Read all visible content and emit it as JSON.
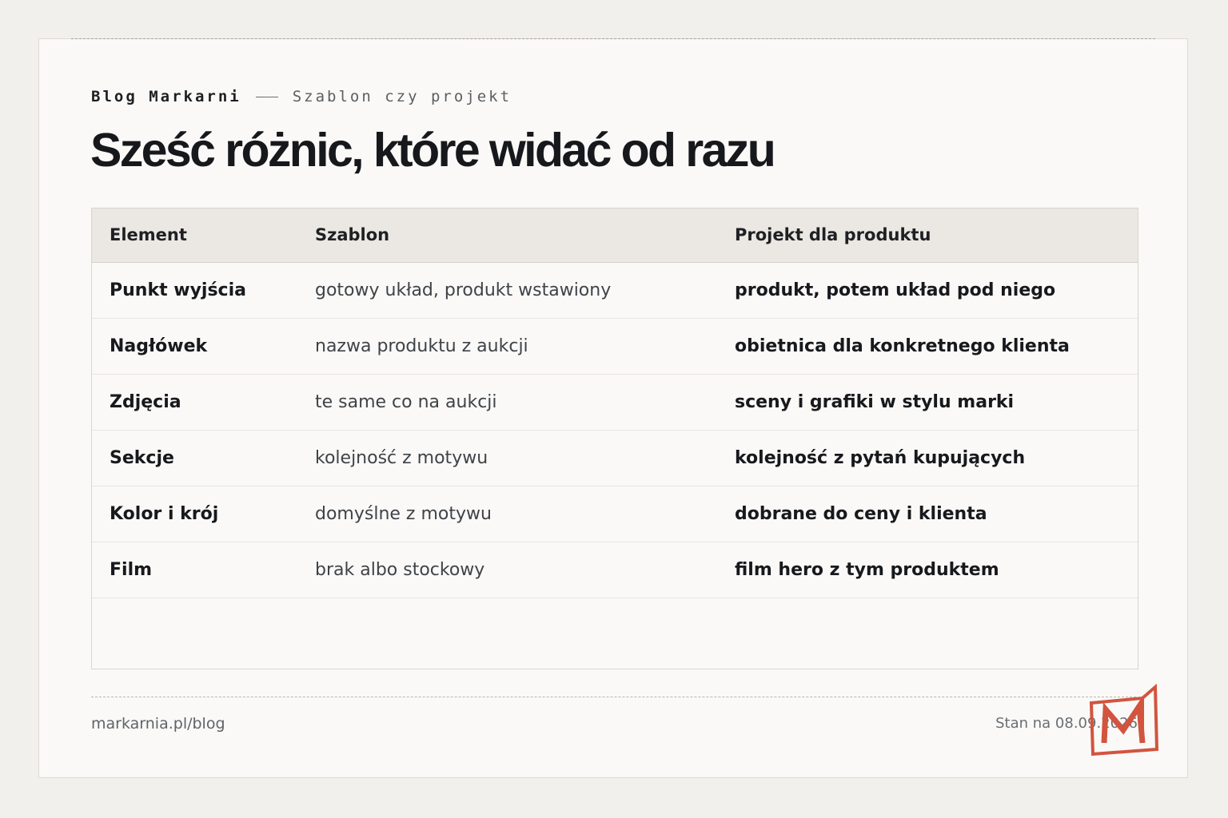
{
  "header": {
    "brand": "Blog Markarni",
    "section": "Szablon czy projekt",
    "title": "Sześć różnic, które widać od razu"
  },
  "table": {
    "columns": [
      "Element",
      "Szablon",
      "Projekt dla produktu"
    ],
    "rows": [
      [
        "Punkt wyjścia",
        "gotowy układ, produkt wstawiony",
        "produkt, potem układ pod niego"
      ],
      [
        "Nagłówek",
        "nazwa produktu z aukcji",
        "obietnica dla konkretnego klienta"
      ],
      [
        "Zdjęcia",
        "te same co na aukcji",
        "sceny i grafiki w stylu marki"
      ],
      [
        "Sekcje",
        "kolejność z motywu",
        "kolejność z pytań kupujących"
      ],
      [
        "Kolor i krój",
        "domyślne z motywu",
        "dobrane do ceny i klienta"
      ],
      [
        "Film",
        "brak albo stockowy",
        "film hero z tym produktem"
      ]
    ]
  },
  "footer": {
    "url": "markarnia.pl/blog",
    "date": "Stan na 08.09.2026"
  },
  "logo": {
    "icon": "markarnia-m-logo",
    "letter": "M",
    "color": "#d2543f"
  },
  "colors": {
    "background": "#f2f0ec",
    "card": "#faf9f7",
    "header_row": "#ebe8e3",
    "text": "#17191d",
    "accent": "#d2543f"
  }
}
